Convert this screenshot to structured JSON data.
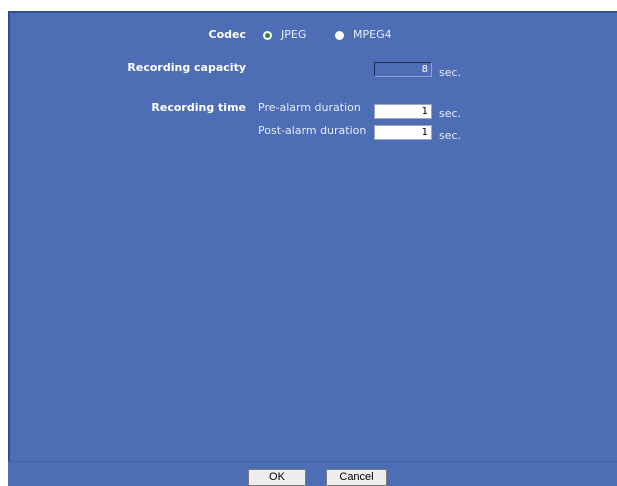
{
  "codec": {
    "label": "Codec",
    "options": [
      {
        "label": "JPEG",
        "selected": true
      },
      {
        "label": "MPEG4",
        "selected": false
      }
    ]
  },
  "recording_capacity": {
    "label": "Recording capacity",
    "value": "8",
    "unit": "sec."
  },
  "recording_time": {
    "label": "Recording time",
    "pre_alarm": {
      "label": "Pre-alarm duration",
      "value": "1",
      "unit": "sec."
    },
    "post_alarm": {
      "label": "Post-alarm duration",
      "value": "1",
      "unit": "sec."
    }
  },
  "buttons": {
    "ok": "OK",
    "cancel": "Cancel"
  },
  "colors": {
    "panel_background": "#4d6eb5",
    "selected_radio": "#2d8f2d"
  }
}
